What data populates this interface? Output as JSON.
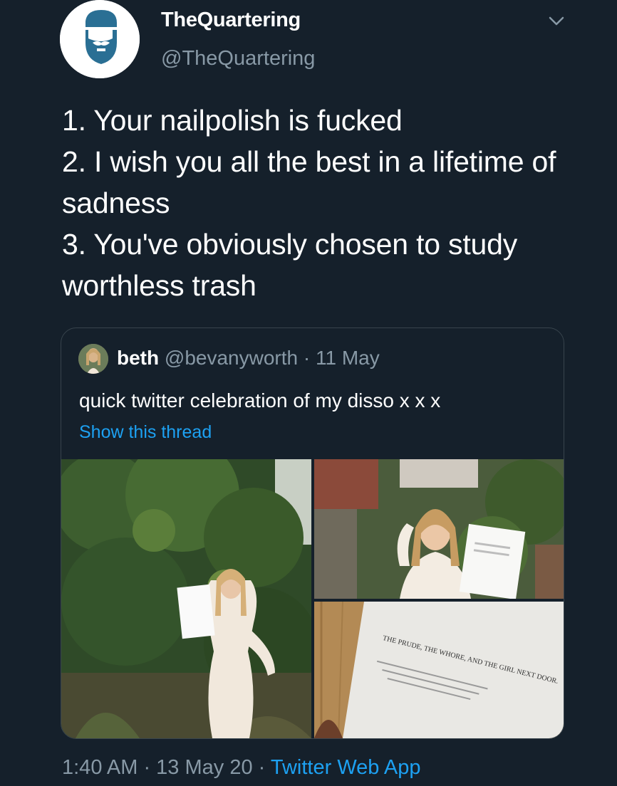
{
  "tweet": {
    "author": {
      "display_name": "TheQuartering",
      "handle": "@TheQuartering",
      "avatar_icon": "bearded-man-logo-icon"
    },
    "menu_icon": "chevron-down-icon",
    "text": "1. Your nailpolish is fucked\n2. I wish you all the best in a lifetime of sadness\n3. You've obviously chosen to study worthless trash",
    "quoted": {
      "display_name": "beth",
      "handle": "@bevanyworth",
      "separator": "·",
      "date": "11 May",
      "text": "quick twitter celebration of my disso x x x",
      "thread_link": "Show this thread",
      "document_title": "THE PRUDE, THE WHORE, AND THE GIRL NEXT DOOR."
    },
    "timestamp": "1:40 AM · 13 May 20",
    "separator": "·",
    "source": "Twitter Web App"
  },
  "colors": {
    "background": "#15202b",
    "secondary_text": "#8899a6",
    "link": "#1da1f2",
    "border": "#38444d"
  }
}
